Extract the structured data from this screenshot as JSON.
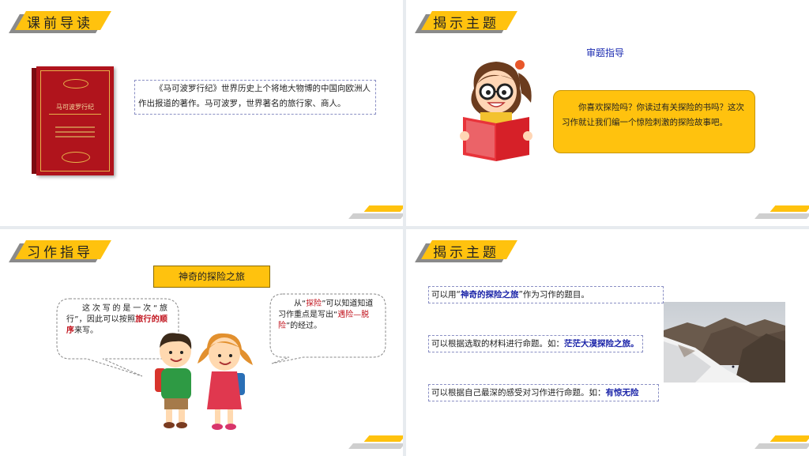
{
  "slide1": {
    "header": "课前导读",
    "book_title": "马可波罗行纪",
    "intro_text": "《马可波罗行纪》世界历史上个将地大物博的中国向欧洲人作出报道的著作。马可波罗，世界著名的旅行家、商人。"
  },
  "slide2": {
    "header": "揭示主题",
    "subtitle": "审题指导",
    "bubble_text": "你喜欢探险吗？你读过有关探险的书吗？这次习作就让我们编一个惊险刺激的探险故事吧。"
  },
  "slide3": {
    "header": "习作指导",
    "topic": "神奇的探险之旅",
    "left_bubble": {
      "t1": "这次写的是一次“旅行”，因此可以按照",
      "highlight": "旅行的顺序",
      "t2": "来写。"
    },
    "right_bubble": {
      "t1": "从“",
      "h1": "探险",
      "t2": "”可以知道知道习作重点是写出“",
      "h2": "遇险—脱险",
      "t3": "”的经过。"
    }
  },
  "slide4": {
    "header": "揭示主题",
    "items": [
      {
        "prefix": "可以用“",
        "highlight": "神奇的探险之旅",
        "suffix": "”作为习作的题目。"
      },
      {
        "prefix": "可以根据选取的材料进行命题。如：",
        "highlight": "茫茫大漠探险之旅。",
        "suffix": ""
      },
      {
        "prefix": "可以根据自己最深的感受对习作进行命题。如：",
        "highlight": "有惊无险",
        "suffix": ""
      }
    ]
  },
  "colors": {
    "accent": "#ffc20e",
    "highlight_red": "#c0111b",
    "highlight_blue": "#1a23a8",
    "book_red": "#b0141c"
  }
}
